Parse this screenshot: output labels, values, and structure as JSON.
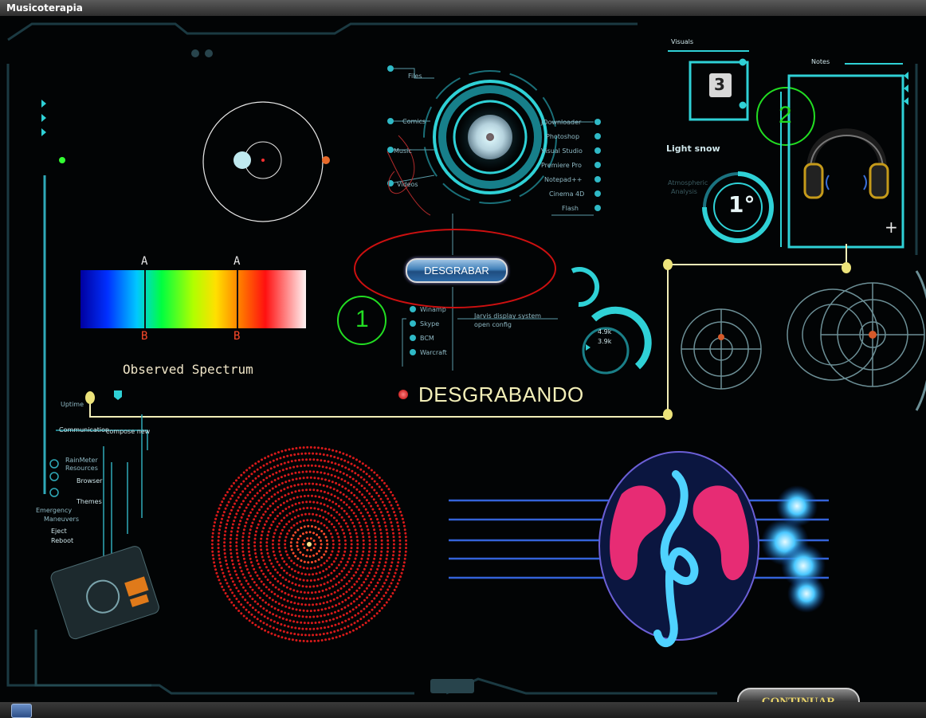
{
  "window": {
    "title": "Musicoterapia"
  },
  "recorder": {
    "button_label": "DESGRABAR",
    "status_text": "DESGRABANDO",
    "annotation_number": "1"
  },
  "headphones": {
    "annotation_number": "2"
  },
  "spectrum": {
    "caption": "Observed Spectrum",
    "top_labels": [
      "A",
      "A"
    ],
    "bottom_labels": [
      "B",
      "B"
    ]
  },
  "hud": {
    "left_menu": [
      "Files",
      "Comics",
      "Music",
      "Videos"
    ],
    "right_menu": [
      "JDownloader",
      "Photoshop",
      "Visual Studio",
      "Premiere Pro",
      "Notepad++",
      "Cinema 4D",
      "Flash"
    ],
    "lower_menu": [
      "Winamp",
      "Skype",
      "BCM",
      "Warcraft"
    ],
    "jarvis_line1": "Jarvis display system",
    "jarvis_line2": "open config",
    "visuals_label": "Visuals",
    "visuals_counter": "3",
    "notes_label": "Notes",
    "weather_title": "Light snow",
    "weather_sub1": "Atmospheric",
    "weather_sub2": "Analysis",
    "temperature": "1°",
    "ring_values": [
      "4.9k",
      "3.9k"
    ],
    "uptime_label": "Uptime",
    "communication_label": "Communication",
    "compose_label": "compose new",
    "side_items": [
      "RainMeter",
      "Resources",
      "Browser",
      "Themes"
    ],
    "emergency": [
      "Emergency",
      "Maneuvers",
      "Eject",
      "Reboot"
    ]
  },
  "actions": {
    "continue_label": "CONTINUAR"
  },
  "colors": {
    "accent": "#2fd1d6",
    "frame_line": "#f3efb8",
    "annotation_red": "#cc1010",
    "annotation_green": "#22dd22"
  }
}
